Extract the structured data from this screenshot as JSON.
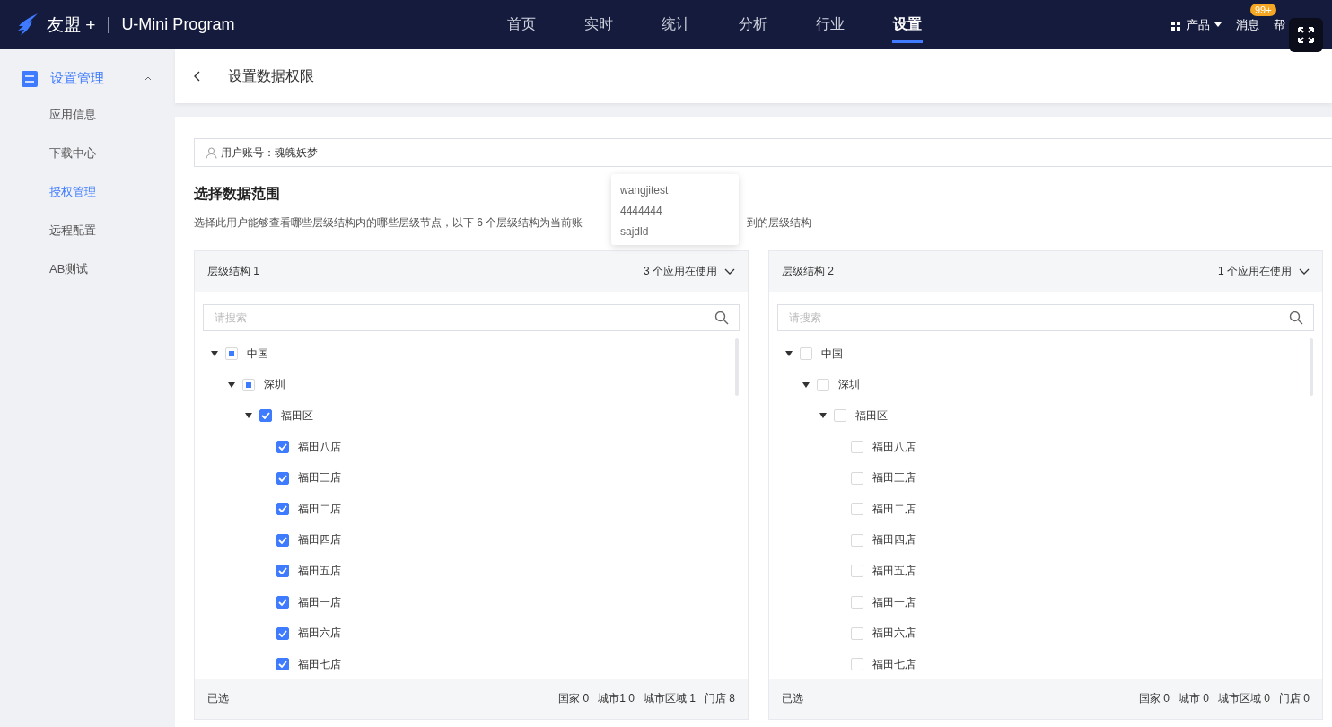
{
  "header": {
    "brand": "友盟 +",
    "product": "U-Mini Program",
    "nav": [
      {
        "label": "首页",
        "selected": false
      },
      {
        "label": "实时",
        "selected": false
      },
      {
        "label": "统计",
        "selected": false
      },
      {
        "label": "分析",
        "selected": false
      },
      {
        "label": "行业",
        "selected": false
      },
      {
        "label": "设置",
        "selected": true
      }
    ],
    "products": "产品",
    "messages": "消息",
    "message_badge": "99+",
    "help": "帮"
  },
  "sidebar": {
    "group": {
      "label": "设置管理",
      "expanded": true
    },
    "items": [
      {
        "label": "应用信息",
        "selected": false
      },
      {
        "label": "下载中心",
        "selected": false
      },
      {
        "label": "授权管理",
        "selected": true
      },
      {
        "label": "远程配置",
        "selected": false
      },
      {
        "label": "AB测试",
        "selected": false
      }
    ]
  },
  "page_title": "设置数据权限",
  "account": "用户账号：魂魄妖梦",
  "section_title": "选择数据范围",
  "description_start": "选择此用户能够查看哪些层级结构内的哪些层级节点，以下 6 个层级结构为当前账",
  "description_end": "到的层级结构",
  "tooltip": [
    "wangjitest",
    "4444444",
    "sajdld"
  ],
  "panels": [
    {
      "title": "层级结构 1",
      "apps": "3 个应用在使用",
      "search_placeholder": "请搜索",
      "tree": [
        {
          "label": "中国",
          "indeterminate": true,
          "expanded": true,
          "children": [
            {
              "label": "深圳",
              "indeterminate": true,
              "expanded": true,
              "children": [
                {
                  "label": "福田区",
                  "checked": true,
                  "expanded": true,
                  "children": [
                    {
                      "label": "福田八店",
                      "checked": true
                    },
                    {
                      "label": "福田三店",
                      "checked": true
                    },
                    {
                      "label": "福田二店",
                      "checked": true
                    },
                    {
                      "label": "福田四店",
                      "checked": true
                    },
                    {
                      "label": "福田五店",
                      "checked": true
                    },
                    {
                      "label": "福田一店",
                      "checked": true
                    },
                    {
                      "label": "福田六店",
                      "checked": true
                    },
                    {
                      "label": "福田七店",
                      "checked": true
                    }
                  ]
                }
              ]
            }
          ]
        }
      ],
      "selected_label": "已选",
      "counts": [
        "国家 0",
        "城市1 0",
        "城市区域 1",
        "门店 8"
      ]
    },
    {
      "title": "层级结构 2",
      "apps": "1 个应用在使用",
      "search_placeholder": "请搜索",
      "tree": [
        {
          "label": "中国",
          "checked": false,
          "expanded": true,
          "children": [
            {
              "label": "深圳",
              "checked": false,
              "expanded": true,
              "children": [
                {
                  "label": "福田区",
                  "checked": false,
                  "expanded": true,
                  "children": [
                    {
                      "label": "福田八店",
                      "checked": false
                    },
                    {
                      "label": "福田三店",
                      "checked": false
                    },
                    {
                      "label": "福田二店",
                      "checked": false
                    },
                    {
                      "label": "福田四店",
                      "checked": false
                    },
                    {
                      "label": "福田五店",
                      "checked": false
                    },
                    {
                      "label": "福田一店",
                      "checked": false
                    },
                    {
                      "label": "福田六店",
                      "checked": false
                    },
                    {
                      "label": "福田七店",
                      "checked": false
                    }
                  ]
                }
              ]
            }
          ]
        }
      ],
      "selected_label": "已选",
      "counts": [
        "国家 0",
        "城市 0",
        "城市区域 0",
        "门店 0"
      ]
    }
  ]
}
